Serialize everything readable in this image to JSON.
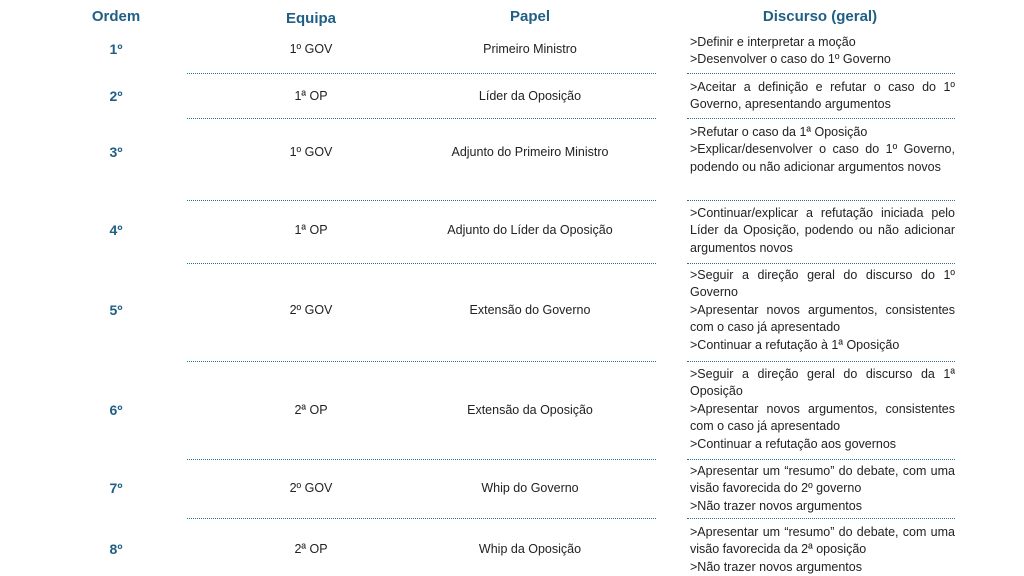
{
  "headers": {
    "ordem": "Ordem",
    "equipa": "Equipa",
    "papel": "Papel",
    "discurso": "Discurso (geral)"
  },
  "rows": [
    {
      "ordem": "1º",
      "equipa": "1º GOV",
      "papel": "Primeiro Ministro",
      "discurso": [
        ">Definir e interpretar a moção",
        ">Desenvolver o caso do 1º Governo"
      ]
    },
    {
      "ordem": "2º",
      "equipa": "1ª OP",
      "papel": "Líder da Oposição",
      "discurso": [
        ">Aceitar a definição e refutar o caso do 1º Governo, apresentando argumentos"
      ]
    },
    {
      "ordem": "3º",
      "equipa": "1º GOV",
      "papel": "Adjunto do Primeiro Ministro",
      "discurso": [
        ">Refutar o caso da 1ª Oposição",
        ">Explicar/desenvolver o caso do 1º Governo, podendo ou não adicionar argumentos novos"
      ]
    },
    {
      "ordem": "4º",
      "equipa": "1ª OP",
      "papel": "Adjunto do Líder da Oposição",
      "discurso": [
        ">Continuar/explicar a refutação iniciada pelo Líder da Oposição, podendo ou não adicionar argumentos novos"
      ]
    },
    {
      "ordem": "5º",
      "equipa": "2º GOV",
      "papel": "Extensão do Governo",
      "discurso": [
        ">Seguir a direção geral do discurso do 1º Governo",
        ">Apresentar novos argumentos, consistentes com o caso já apresentado",
        ">Continuar a refutação à 1ª Oposição"
      ]
    },
    {
      "ordem": "6º",
      "equipa": "2ª OP",
      "papel": "Extensão da Oposição",
      "discurso": [
        ">Seguir a direção geral do discurso da 1ª Oposição",
        ">Apresentar novos argumentos, consistentes com o caso já apresentado",
        ">Continuar a refutação aos governos"
      ]
    },
    {
      "ordem": "7º",
      "equipa": "2º GOV",
      "papel": "Whip do Governo",
      "discurso": [
        ">Apresentar um “resumo” do debate, com uma visão favorecida do 2º governo",
        ">Não trazer novos argumentos"
      ]
    },
    {
      "ordem": "8º",
      "equipa": "2ª OP",
      "papel": "Whip da Oposição",
      "discurso": [
        ">Apresentar um “resumo” do debate, com uma visão favorecida da 2ª oposição",
        ">Não trazer novos argumentos"
      ]
    }
  ],
  "colors": {
    "accent": "#1f5f86",
    "separator": "#2a6f94"
  }
}
